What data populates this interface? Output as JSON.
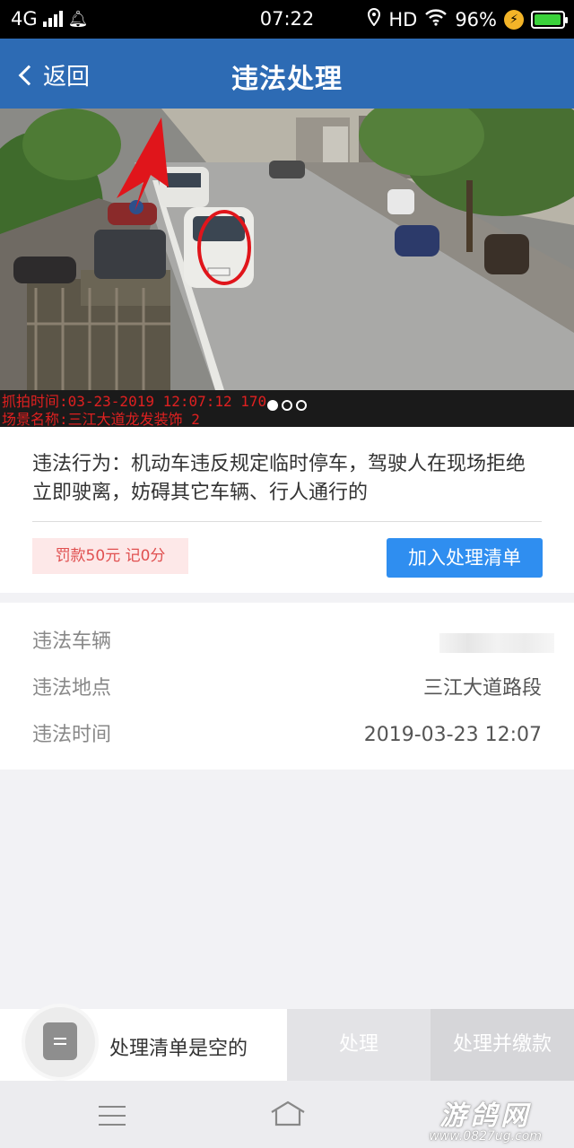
{
  "status_bar": {
    "network": "4G",
    "time": "07:22",
    "hd": "HD",
    "battery": "96%",
    "battery_level": 0.96
  },
  "header": {
    "back_label": "返回",
    "title": "违法处理"
  },
  "photo": {
    "caption_line1": "抓拍时间:03-23-2019 12:07:12 170",
    "caption_line2": "场景名称:三江大道龙发装饰_2",
    "pages": 3,
    "current_page": 1
  },
  "violation": {
    "behavior": "违法行为：机动车违反规定临时停车，驾驶人在现场拒绝立即驶离，妨碍其它车辆、行人通行的",
    "penalty": "罚款50元 记0分",
    "add_button": "加入处理清单"
  },
  "details": {
    "vehicle_label": "违法车辆",
    "location_label": "违法地点",
    "location_value": "三江大道路段",
    "time_label": "违法时间",
    "time_value": "2019-03-23 12:07"
  },
  "action_bar": {
    "cart_text": "处理清单是空的",
    "handle_button": "处理",
    "pay_button": "处理并缴款"
  },
  "watermark": {
    "line1": "游鸽网",
    "line2": "www.0827ug.com"
  },
  "colors": {
    "header": "#2d6bb4",
    "accent_button": "#2f8ef0",
    "penalty_bg": "#fde8e8",
    "penalty_text": "#e05050",
    "annotation_red": "#e0151b"
  }
}
